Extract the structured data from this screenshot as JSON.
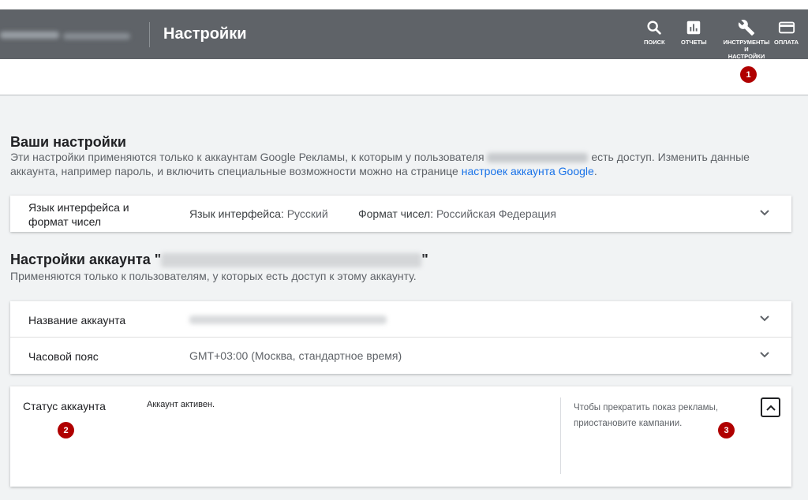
{
  "header": {
    "title": "Настройки",
    "buttons": {
      "search": "ПОИСК",
      "reports": "ОТЧЕТЫ",
      "tools_line1": "ИНСТРУМЕНТЫ",
      "tools_line2": "И",
      "tools_line3": "НАСТРОЙКИ",
      "billing": "ОПЛАТА"
    }
  },
  "markers": {
    "m1": "1",
    "m2": "2",
    "m3": "3"
  },
  "your_settings": {
    "title": "Ваши настройки",
    "desc_part1": "Эти настройки применяются только к аккаунтам Google Рекламы, к которым у пользователя",
    "desc_part2": "есть доступ. Изменить данные аккаунта, например пароль, и включить специальные возможности можно на странице",
    "desc_link": "настроек аккаунта Google",
    "desc_end": ".",
    "language_row": {
      "label_line1": "Язык интерфейса и",
      "label_line2": "формат чисел",
      "lang_key": "Язык интерфейса:",
      "lang_value": "Русский",
      "format_key": "Формат чисел:",
      "format_value": "Российская Федерация"
    }
  },
  "account_settings": {
    "title_prefix": "Настройки аккаунта \"",
    "title_suffix": "\"",
    "desc": "Применяются только к пользователям, у которых есть доступ к этому аккаунту.",
    "rows": [
      {
        "label": "Название аккаунта"
      },
      {
        "label": "Часовой пояс",
        "value": "GMT+03:00 (Москва, стандартное время)"
      }
    ]
  },
  "status": {
    "label": "Статус аккаунта",
    "value": "Аккаунт активен.",
    "note_line1": "Чтобы прекратить показ рекламы,",
    "note_line2": "приостановите кампании."
  },
  "colors": {
    "header_bg": "#5f6368",
    "marker": "#b00000",
    "link": "#1a73e8"
  }
}
